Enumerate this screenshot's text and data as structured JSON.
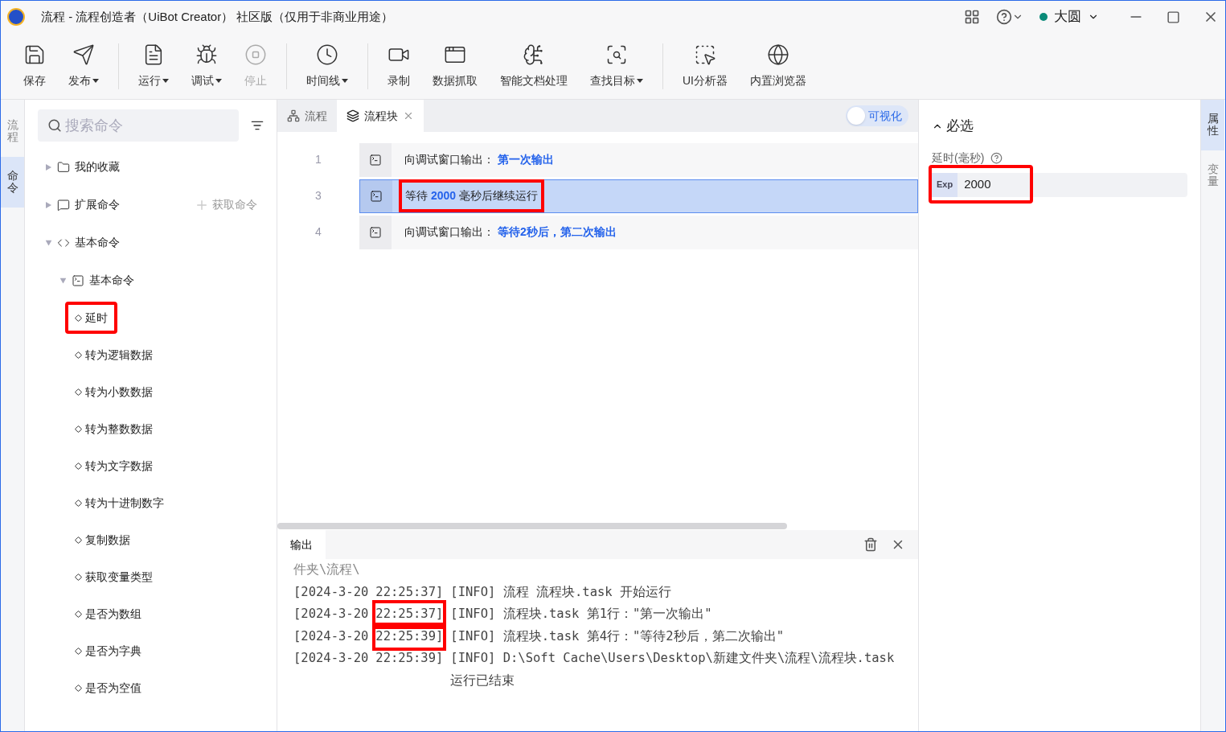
{
  "window": {
    "title": "流程 - 流程创造者（UiBot Creator） 社区版（仅用于非商业用途）",
    "user": "大圆"
  },
  "toolbar": [
    [
      {
        "label": "保存",
        "kind": "save",
        "dropdown": false,
        "disabled": false
      },
      {
        "label": "发布",
        "kind": "publish",
        "dropdown": true,
        "disabled": false
      }
    ],
    [
      {
        "label": "运行",
        "kind": "run",
        "dropdown": true,
        "disabled": false
      },
      {
        "label": "调试",
        "kind": "debug",
        "dropdown": true,
        "disabled": false
      },
      {
        "label": "停止",
        "kind": "stop",
        "dropdown": false,
        "disabled": true
      }
    ],
    [
      {
        "label": "时间线",
        "kind": "timeline",
        "dropdown": true,
        "disabled": false
      }
    ],
    [
      {
        "label": "录制",
        "kind": "record",
        "dropdown": false,
        "disabled": false
      },
      {
        "label": "数据抓取",
        "kind": "scrape",
        "dropdown": false,
        "disabled": false
      },
      {
        "label": "智能文档处理",
        "kind": "ai",
        "dropdown": false,
        "disabled": false
      },
      {
        "label": "查找目标",
        "kind": "find",
        "dropdown": true,
        "disabled": false
      }
    ],
    [
      {
        "label": "UI分析器",
        "kind": "analyzer",
        "dropdown": false,
        "disabled": false
      },
      {
        "label": "内置浏览器",
        "kind": "browser",
        "dropdown": false,
        "disabled": false
      }
    ]
  ],
  "left_rail": [
    {
      "label": "流程",
      "selected": false
    },
    {
      "label": "命令",
      "selected": true
    }
  ],
  "search": {
    "placeholder": "搜索命令"
  },
  "tree": [
    {
      "label": "我的收藏",
      "kind": "folder",
      "expanded": false
    },
    {
      "label": "扩展命令",
      "kind": "extension",
      "expanded": false,
      "action": "获取命令"
    },
    {
      "label": "基本命令",
      "kind": "code",
      "expanded": true,
      "children": [
        {
          "label": "基本命令",
          "kind": "terminal",
          "expanded": true,
          "children": [
            {
              "label": "延时",
              "kind": "leaf",
              "marked": true
            },
            {
              "label": "转为逻辑数据",
              "kind": "leaf",
              "marked": false
            },
            {
              "label": "转为小数数据",
              "kind": "leaf",
              "marked": false
            },
            {
              "label": "转为整数数据",
              "kind": "leaf",
              "marked": false
            },
            {
              "label": "转为文字数据",
              "kind": "leaf",
              "marked": false
            },
            {
              "label": "转为十进制数字",
              "kind": "leaf",
              "marked": false
            },
            {
              "label": "复制数据",
              "kind": "leaf",
              "marked": false
            },
            {
              "label": "获取变量类型",
              "kind": "leaf",
              "marked": false
            },
            {
              "label": "是否为数组",
              "kind": "leaf",
              "marked": false
            },
            {
              "label": "是否为字典",
              "kind": "leaf",
              "marked": false
            },
            {
              "label": "是否为空值",
              "kind": "leaf",
              "marked": false
            }
          ]
        }
      ]
    }
  ],
  "editor_tabs": [
    {
      "label": "流程",
      "kind": "flow",
      "selected": false,
      "closable": false
    },
    {
      "label": "流程块",
      "kind": "block",
      "selected": true,
      "closable": true
    }
  ],
  "visual_toggle": {
    "label": "可视化",
    "on": false
  },
  "steps": [
    {
      "number": "1",
      "text": "向调试窗口输出： **第一次输出**",
      "selected": false,
      "marked": false
    },
    {
      "number": "3",
      "text": "等待 **2000** 毫秒后继续运行",
      "selected": true,
      "marked": true
    },
    {
      "number": "4",
      "text": "向调试窗口输出： **等待2秒后，第二次输出**",
      "selected": false,
      "marked": false
    }
  ],
  "output": {
    "title": "输出",
    "lines": [
      {
        "text": "件夹\\流程\\",
        "kind": "fragment"
      },
      {
        "date": "[2024-3-20",
        "time": "22:25:37]",
        "message": "[INFO] 流程 流程块.task 开始运行",
        "time_marked": false
      },
      {
        "date": "[2024-3-20",
        "time": "22:25:37]",
        "message": "[INFO] 流程块.task 第1行：\"第一次输出\"",
        "time_marked": true
      },
      {
        "date": "[2024-3-20",
        "time": "22:25:39]",
        "message": "[INFO] 流程块.task 第4行：\"等待2秒后，第二次输出\"",
        "time_marked": true
      },
      {
        "date": "[2024-3-20",
        "time": "22:25:39]",
        "message": "[INFO] D:\\Soft Cache\\Users\\Desktop\\新建文件夹\\流程\\流程块.task 运行已结束",
        "time_marked": false
      }
    ]
  },
  "properties": {
    "section": "必选",
    "expanded": true,
    "fields": [
      {
        "label": "延时(毫秒)",
        "prefix": "Exp",
        "value": "2000",
        "marked": true
      }
    ]
  },
  "right_rail": [
    {
      "label": "属性",
      "selected": true
    },
    {
      "label": "变量",
      "selected": false
    }
  ]
}
